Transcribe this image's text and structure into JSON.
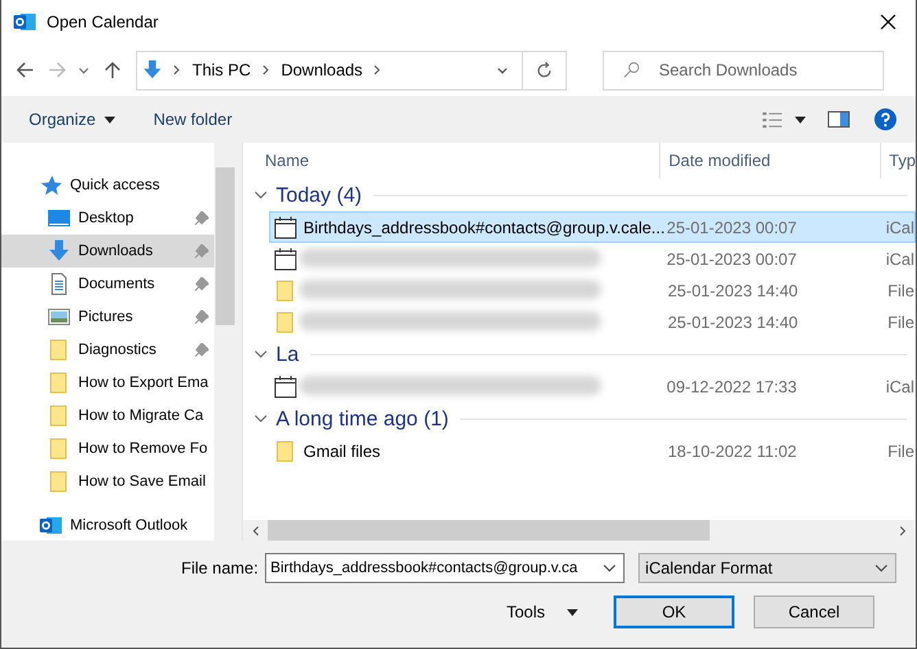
{
  "window": {
    "title": "Open Calendar"
  },
  "address": {
    "crumbs": [
      "This PC",
      "Downloads"
    ]
  },
  "search": {
    "placeholder": "Search Downloads"
  },
  "toolbar": {
    "organize": "Organize",
    "new_folder": "New folder"
  },
  "sidebar": {
    "items": [
      {
        "kind": "star",
        "label": "Quick access",
        "pinned": false,
        "selected": false
      },
      {
        "kind": "desktop",
        "label": "Desktop",
        "pinned": true,
        "selected": false
      },
      {
        "kind": "download",
        "label": "Downloads",
        "pinned": true,
        "selected": true
      },
      {
        "kind": "document",
        "label": "Documents",
        "pinned": true,
        "selected": false
      },
      {
        "kind": "pictures",
        "label": "Pictures",
        "pinned": true,
        "selected": false
      },
      {
        "kind": "folder",
        "label": "Diagnostics",
        "pinned": true,
        "selected": false
      },
      {
        "kind": "folder",
        "label": "How to Export Ema",
        "pinned": false,
        "selected": false
      },
      {
        "kind": "folder",
        "label": "How to Migrate Ca",
        "pinned": false,
        "selected": false
      },
      {
        "kind": "folder",
        "label": "How to Remove Fo",
        "pinned": false,
        "selected": false
      },
      {
        "kind": "folder",
        "label": "How to Save Email",
        "pinned": false,
        "selected": false
      },
      {
        "kind": "outlook",
        "label": "Microsoft Outlook",
        "pinned": false,
        "selected": false
      }
    ]
  },
  "table": {
    "columns": [
      "Name",
      "Date modified",
      "Typ"
    ],
    "groups": [
      {
        "label": "Today (4)",
        "files": [
          {
            "kind": "calendar",
            "name": "Birthdays_addressbook#contacts@group.v.cale...",
            "date": "25-01-2023 00:07",
            "type": "iCal",
            "selected": true,
            "blurred": false
          },
          {
            "kind": "calendar",
            "date": "25-01-2023 00:07",
            "type": "iCal",
            "selected": false,
            "blurred": true
          },
          {
            "kind": "folder",
            "date": "25-01-2023 14:40",
            "type": "File",
            "selected": false,
            "blurred": true
          },
          {
            "kind": "folder",
            "date": "25-01-2023 14:40",
            "type": "File",
            "selected": false,
            "blurred": true
          }
        ]
      },
      {
        "label": "La",
        "files": [
          {
            "kind": "calendar",
            "date": "09-12-2022 17:33",
            "type": "iCal",
            "selected": false,
            "blurred": true
          }
        ]
      },
      {
        "label": "A long time ago (1)",
        "files": [
          {
            "kind": "folder",
            "name": "Gmail files",
            "date": "18-10-2022 11:02",
            "type": "File",
            "selected": false,
            "blurred": false
          }
        ]
      }
    ]
  },
  "footer": {
    "file_name_label": "File name:",
    "file_name": "Birthdays_addressbook#contacts@group.v.ca",
    "format": "iCalendar Format",
    "tools": "Tools",
    "ok": "OK",
    "cancel": "Cancel"
  }
}
